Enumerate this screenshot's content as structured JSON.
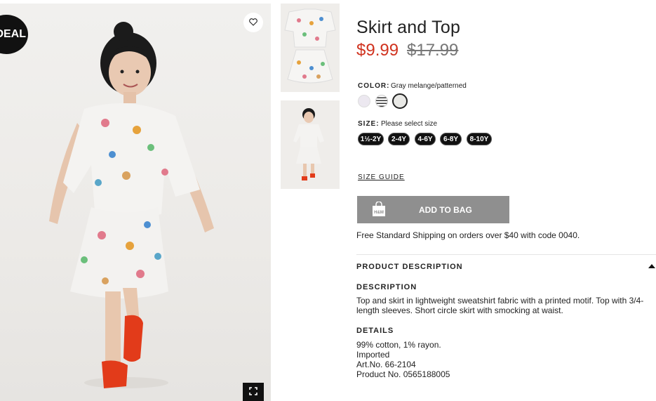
{
  "badge": "DEAL",
  "product": {
    "title": "Skirt and Top",
    "price_sale": "$9.99",
    "price_old": "$17.99"
  },
  "color": {
    "label": "COLOR:",
    "value": "Gray melange/patterned",
    "swatches": [
      "#ece8f0",
      "#333333",
      "#e9e9e6"
    ]
  },
  "size": {
    "label": "SIZE:",
    "value": "Please select size",
    "options": [
      "1½-2Y",
      "2-4Y",
      "4-6Y",
      "6-8Y",
      "8-10Y"
    ]
  },
  "size_guide": "SIZE GUIDE",
  "add_to_bag": "ADD TO BAG",
  "brand_logo": "H&M",
  "shipping": "Free Standard Shipping on orders over $40 with code 0040.",
  "product_description": {
    "header": "PRODUCT DESCRIPTION",
    "description_label": "DESCRIPTION",
    "description_text": "Top and skirt in lightweight sweatshirt fabric with a printed motif. Top with 3/4-length sleeves. Short circle skirt with smocking at waist.",
    "details_label": "DETAILS",
    "details": [
      "99% cotton, 1% rayon.",
      "Imported",
      "Art.No. 66-2104",
      "Product No. 0565188005"
    ]
  },
  "colors": {
    "sale": "#d0321e",
    "button": "#8f8f8f",
    "badge": "#111111"
  }
}
